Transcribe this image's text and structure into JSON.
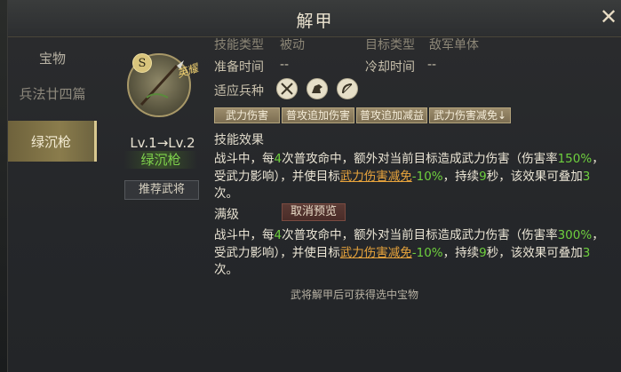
{
  "window": {
    "title": "解甲",
    "close_glyph": "✕"
  },
  "sidebar": {
    "items": [
      {
        "label": "宝物",
        "active": false
      },
      {
        "label": "兵法廿四篇",
        "active": false
      },
      {
        "label": "绿沉枪",
        "active": true
      }
    ]
  },
  "item": {
    "level_badge": "S",
    "grade_stamp": "英耀",
    "level_text": "Lv.1→Lv.2",
    "name": "绿沉枪",
    "recommend_label": "推荐武将",
    "name_color": "#7fd24c"
  },
  "info": {
    "cut_row": {
      "label1": "技能类型",
      "value1": "被动",
      "label2": "目标类型",
      "value2": "敌军单体"
    },
    "prep": {
      "label": "准备时间",
      "value": "--"
    },
    "cooldown": {
      "label": "冷却时间",
      "value": "--"
    },
    "troop": {
      "label": "适应兵种",
      "icons": [
        "crossed-swords-icon",
        "horse-icon",
        "bow-icon"
      ]
    },
    "tags": [
      "武力伤害",
      "普攻追加伤害",
      "普攻追加减益",
      "武力伤害减免↓"
    ]
  },
  "effect": {
    "title": "技能效果",
    "p1": "战斗中，每",
    "n1": "4",
    "p2": "次普攻命中，额外对当前目标造成武力伤害（伤害率",
    "rate": "150%",
    "p3": "，受武力影响），并使目标",
    "link": "武力伤害减免",
    "neg": "-10%",
    "p4": "，持续",
    "n2": "9",
    "p5": "秒，该效果可叠加",
    "n3": "3",
    "p6": "次。"
  },
  "max_level": {
    "title": "满级",
    "cancel_label": "取消预览",
    "p1": "战斗中，每",
    "n1": "4",
    "p2": "次普攻命中，额外对当前目标造成武力伤害（伤害率",
    "rate": "300%",
    "p3": "，受武力影响），并使目标",
    "link": "武力伤害减免",
    "neg": "-10%",
    "p4": "，持续",
    "n2": "9",
    "p5": "秒，该效果可叠加",
    "n3": "3",
    "p6": "次。"
  },
  "footer": "武将解甲后可获得选中宝物",
  "colors": {
    "accent_green": "#6ecf3e",
    "link_orange": "#e8a43c",
    "active_tab": "#8a7c4c"
  }
}
